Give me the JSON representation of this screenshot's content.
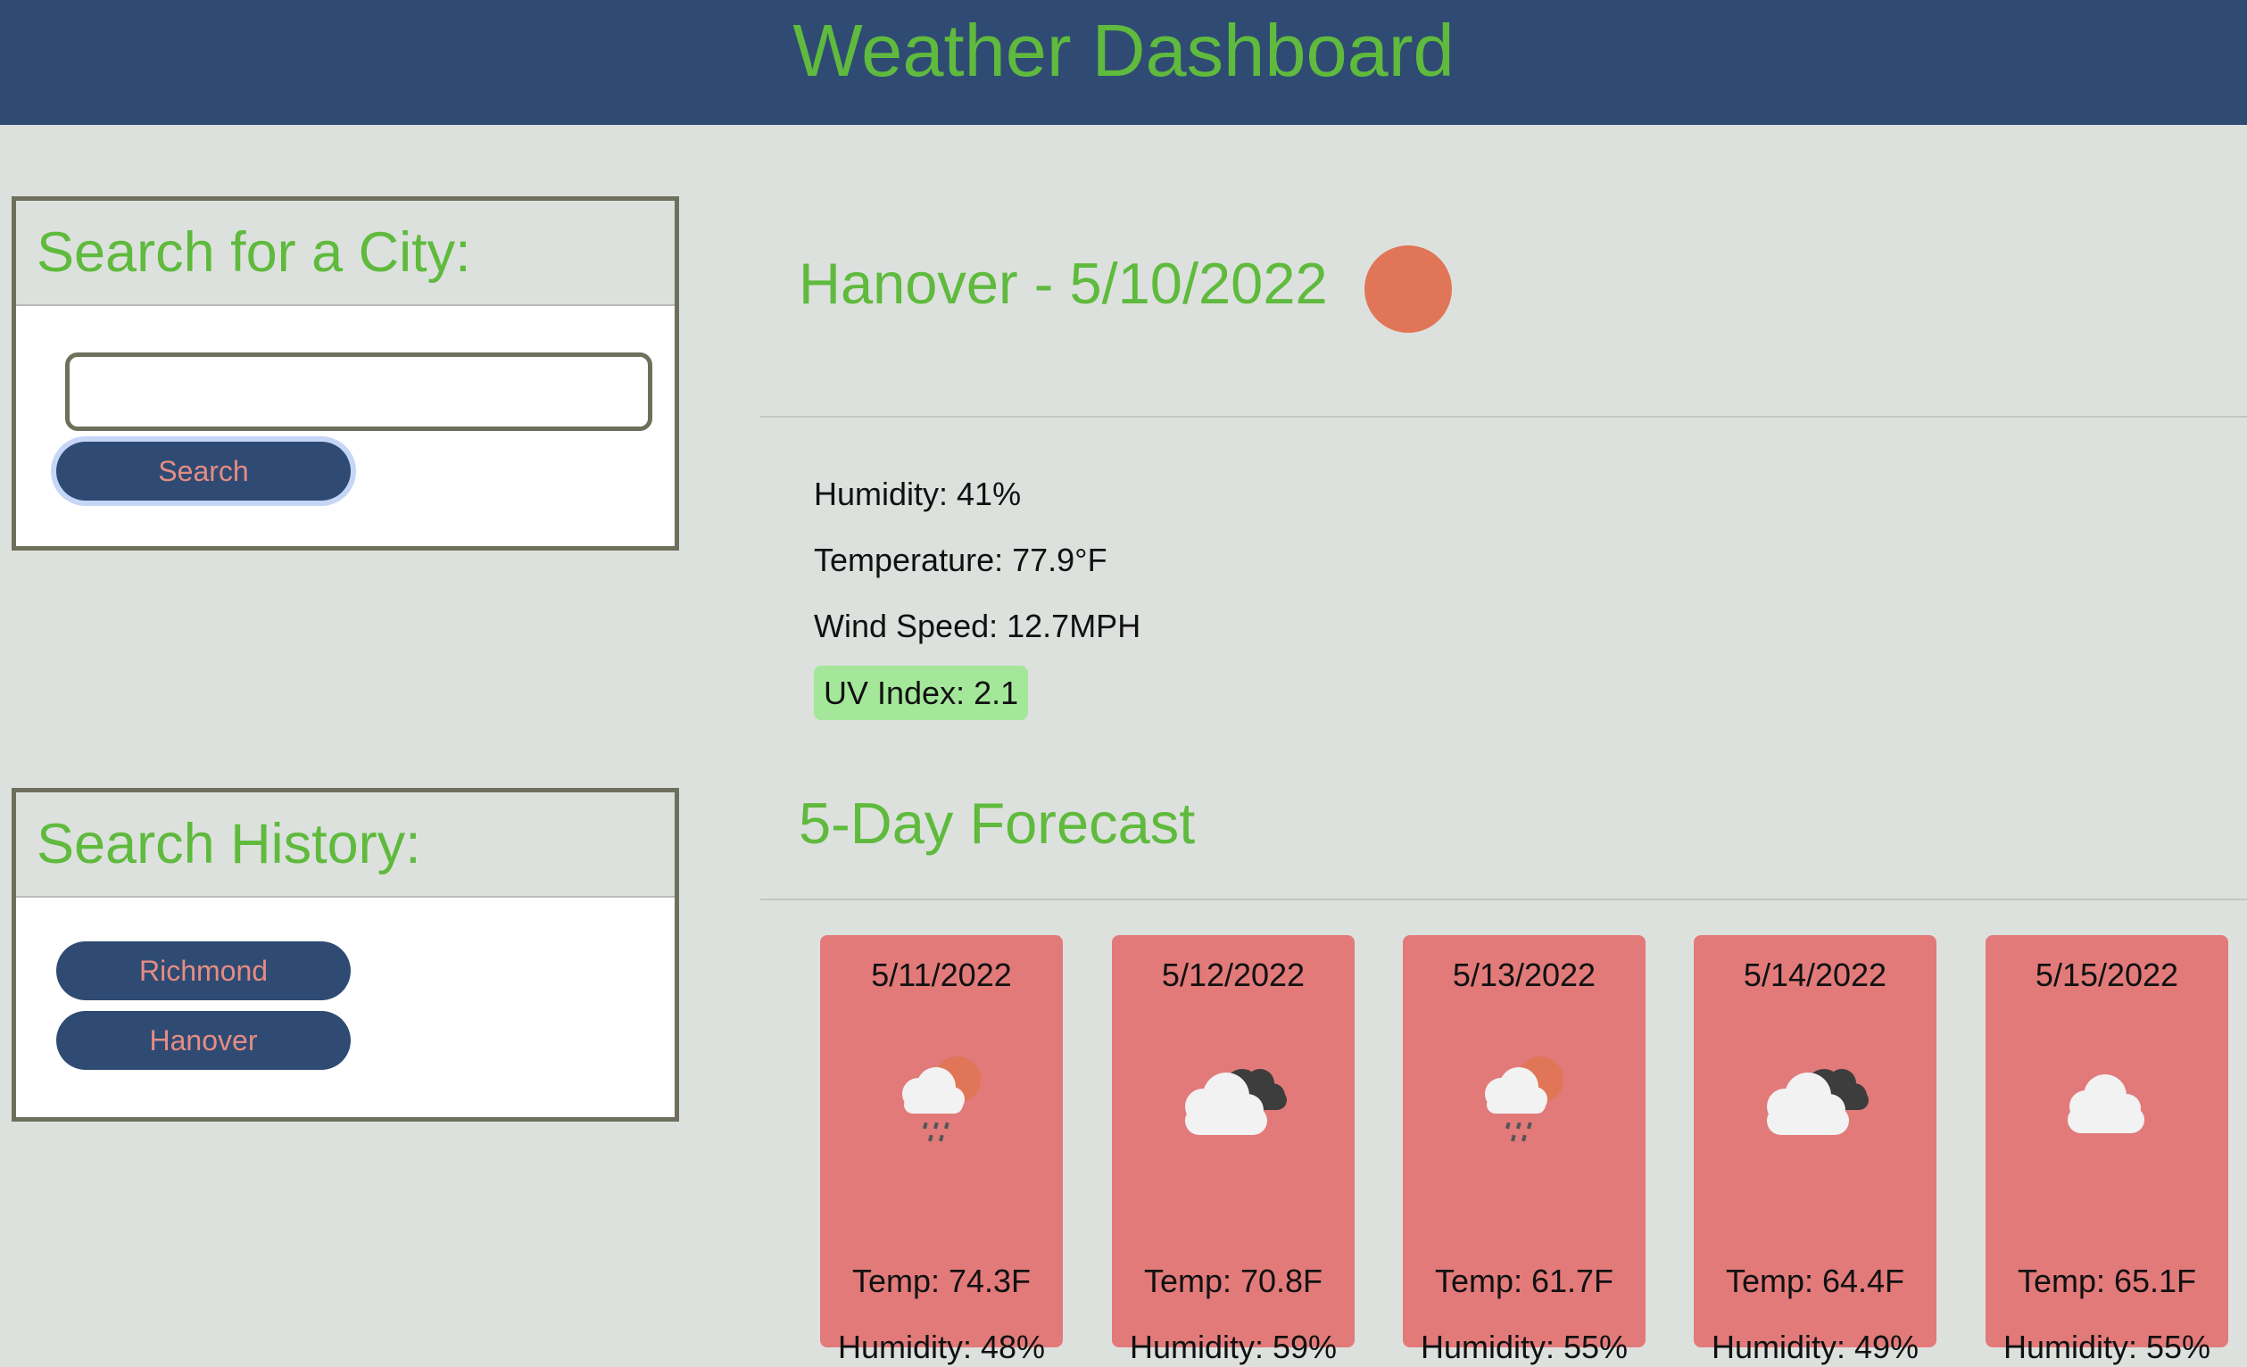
{
  "header": {
    "title": "Weather Dashboard"
  },
  "search_panel": {
    "title": "Search for a City:",
    "input_value": "",
    "input_placeholder": "",
    "button_label": "Search"
  },
  "history_panel": {
    "title": "Search History:",
    "items": [
      {
        "label": "Richmond"
      },
      {
        "label": "Hanover"
      }
    ]
  },
  "current": {
    "heading": "Hanover - 5/10/2022",
    "icon": "sun-icon",
    "humidity": "Humidity: 41%",
    "temperature": "Temperature: 77.9°F",
    "wind": "Wind Speed: 12.7MPH",
    "uv": "UV Index: 2.1",
    "uv_color": "#a4e79a"
  },
  "forecast": {
    "title": "5-Day Forecast",
    "days": [
      {
        "date": "5/11/2022",
        "icon": "sun-cloud-rain-icon",
        "temp": "Temp: 74.3F",
        "humidity": "Humidity: 48%"
      },
      {
        "date": "5/12/2022",
        "icon": "broken-clouds-icon",
        "temp": "Temp: 70.8F",
        "humidity": "Humidity: 59%"
      },
      {
        "date": "5/13/2022",
        "icon": "sun-cloud-rain-icon",
        "temp": "Temp: 61.7F",
        "humidity": "Humidity: 55%"
      },
      {
        "date": "5/14/2022",
        "icon": "broken-clouds-icon",
        "temp": "Temp: 64.4F",
        "humidity": "Humidity: 49%"
      },
      {
        "date": "5/15/2022",
        "icon": "cloud-icon",
        "temp": "Temp: 65.1F",
        "humidity": "Humidity: 55%"
      }
    ]
  },
  "colors": {
    "header_bg": "#2f4b73",
    "accent_green": "#5fba3d",
    "card_bg": "#e27a7a",
    "button_text": "#e58c83",
    "page_bg": "#dde1de"
  }
}
